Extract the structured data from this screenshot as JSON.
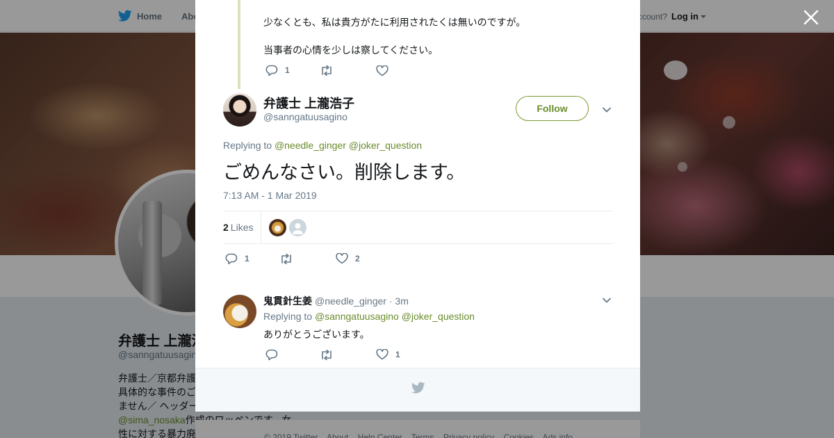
{
  "topbar": {
    "home_label": "Home",
    "about_label_partial": "Abo",
    "have_account_partial": "ccount?",
    "login_label": "Log in"
  },
  "profile": {
    "name": "弁護士 上瀧浩子",
    "handle": "@sanngatuusagino",
    "bio_lines": [
      "弁護士／京都弁護",
      "具体的な事件のご",
      "ません／ ヘッダー"
    ],
    "bio_mention": "@sima_nosaka",
    "bio_after_mention": "作成のワッペンです。女",
    "bio_last_line": "性に対する暴力廃"
  },
  "parent_tweet": {
    "lines": [
      "少なくとも、私は貴方がたに利用されたくは無いのですが。",
      "当事者の心情を少しは察してください。"
    ],
    "reply_count": "1"
  },
  "main_tweet": {
    "author_name": "弁護士 上瀧浩子",
    "author_handle": "@sanngatuusagino",
    "follow_label": "Follow",
    "replying_label": "Replying to",
    "reply_to_1": "@needle_ginger",
    "reply_to_2": "@joker_question",
    "text": "ごめんなさい。削除します。",
    "timestamp": "7:13 AM - 1 Mar 2019",
    "likes_count": "2",
    "likes_label": "Likes",
    "reply_count": "1",
    "like_count": "2"
  },
  "reply_tweet": {
    "author_name": "鬼貫針生姜",
    "author_handle": "@needle_ginger",
    "time_ago": "· 3m",
    "replying_label": "Replying to",
    "reply_to_1": "@sanngatuusagino",
    "reply_to_2": "@joker_question",
    "text": "ありがとうございます。",
    "like_count": "1"
  },
  "footer": {
    "links": [
      "© 2019 Twitter",
      "About",
      "Help Center",
      "Terms",
      "Privacy policy",
      "Cookies",
      "Ads info"
    ]
  },
  "colors": {
    "accent": "#6a8c2c",
    "follow_border": "#7a9a2e",
    "thread_line": "#d9e3bd",
    "muted_text": "#657786"
  },
  "icons": [
    "twitter-bird-icon",
    "close-icon",
    "reply-icon",
    "retweet-icon",
    "heart-icon",
    "chevron-down-icon"
  ]
}
